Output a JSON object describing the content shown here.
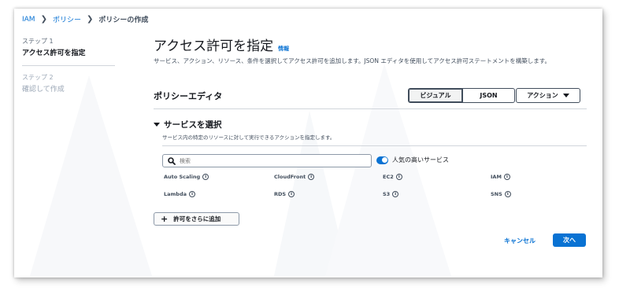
{
  "breadcrumb": {
    "items": [
      "IAM",
      "ポリシー",
      "ポリシーの作成"
    ]
  },
  "steps": [
    {
      "label": "ステップ 1",
      "title": "アクセス許可を指定"
    },
    {
      "label": "ステップ 2",
      "title": "確認して作成"
    }
  ],
  "page": {
    "title": "アクセス許可を指定",
    "info_link": "情報",
    "description": "サービス、アクション、リソース、条件を選択してアクセス許可を追加します。JSON エディタを使用してアクセス許可ステートメントを構築します。"
  },
  "editor": {
    "title": "ポリシーエディタ",
    "visual_label": "ビジュアル",
    "json_label": "JSON",
    "actions_label": "アクション"
  },
  "section": {
    "title": "サービスを選択",
    "description": "サービス内の特定のリソースに対して実行できるアクションを指定します。"
  },
  "search": {
    "placeholder": "検索"
  },
  "toggle": {
    "label": "人気の高いサービス",
    "on": true
  },
  "services": [
    "Auto Scaling",
    "CloudFront",
    "EC2",
    "IAM",
    "Lambda",
    "RDS",
    "S3",
    "SNS"
  ],
  "footer": {
    "add_label": "許可をさらに追加",
    "cancel_label": "キャンセル",
    "next_label": "次へ"
  },
  "colors": {
    "accent": "#0972d3",
    "text": "#16191f",
    "muted": "#5f6b7a"
  }
}
